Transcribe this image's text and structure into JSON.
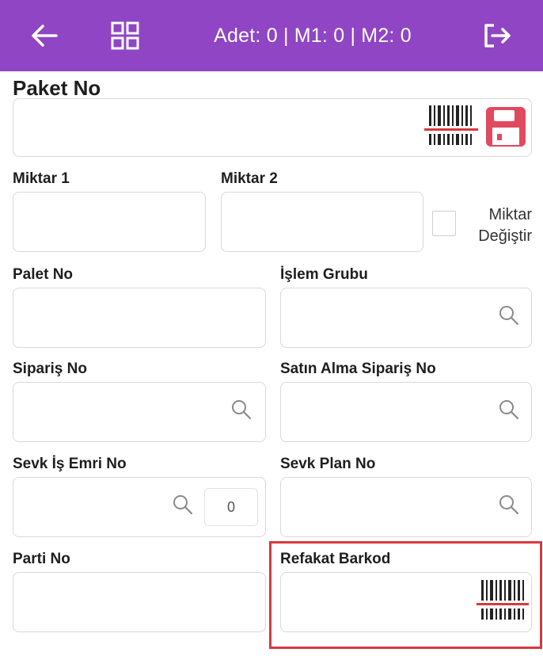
{
  "header": {
    "title": "Adet: 0 | M1: 0 | M2: 0",
    "back_icon": "arrow-left-icon",
    "menu_icon": "grid-icon",
    "exit_icon": "logout-icon",
    "bar_color": "#8f45c4"
  },
  "paket_no": {
    "label": "Paket No",
    "value": "",
    "barcode_icon": "barcode-icon",
    "save_icon": "save-icon"
  },
  "miktar1": {
    "label": "Miktar 1",
    "value": ""
  },
  "miktar2": {
    "label": "Miktar 2",
    "value": ""
  },
  "miktar_degistir": {
    "line1": "Miktar",
    "line2": "Değiştir",
    "checked": false
  },
  "palet_no": {
    "label": "Palet No",
    "value": ""
  },
  "islem_grubu": {
    "label": "İşlem Grubu",
    "value": "",
    "icon": "search-icon"
  },
  "siparis_no": {
    "label": "Sipariş No",
    "value": "",
    "icon": "search-icon"
  },
  "satin_alma": {
    "label": "Satın Alma Sipariş No",
    "value": "",
    "icon": "search-icon"
  },
  "sevk_is_emri": {
    "label": "Sevk İş Emri No",
    "value": "",
    "icon": "search-icon",
    "count": "0"
  },
  "sevk_plan": {
    "label": "Sevk Plan No",
    "value": "",
    "icon": "search-icon"
  },
  "parti_no": {
    "label": "Parti No",
    "value": ""
  },
  "refakat_barkod": {
    "label": "Refakat Barkod",
    "value": "",
    "icon": "barcode-icon"
  },
  "colors": {
    "highlight": "#d63a3f",
    "save_icon": "#e04a5e",
    "barcode_line": "#d63a3f"
  }
}
